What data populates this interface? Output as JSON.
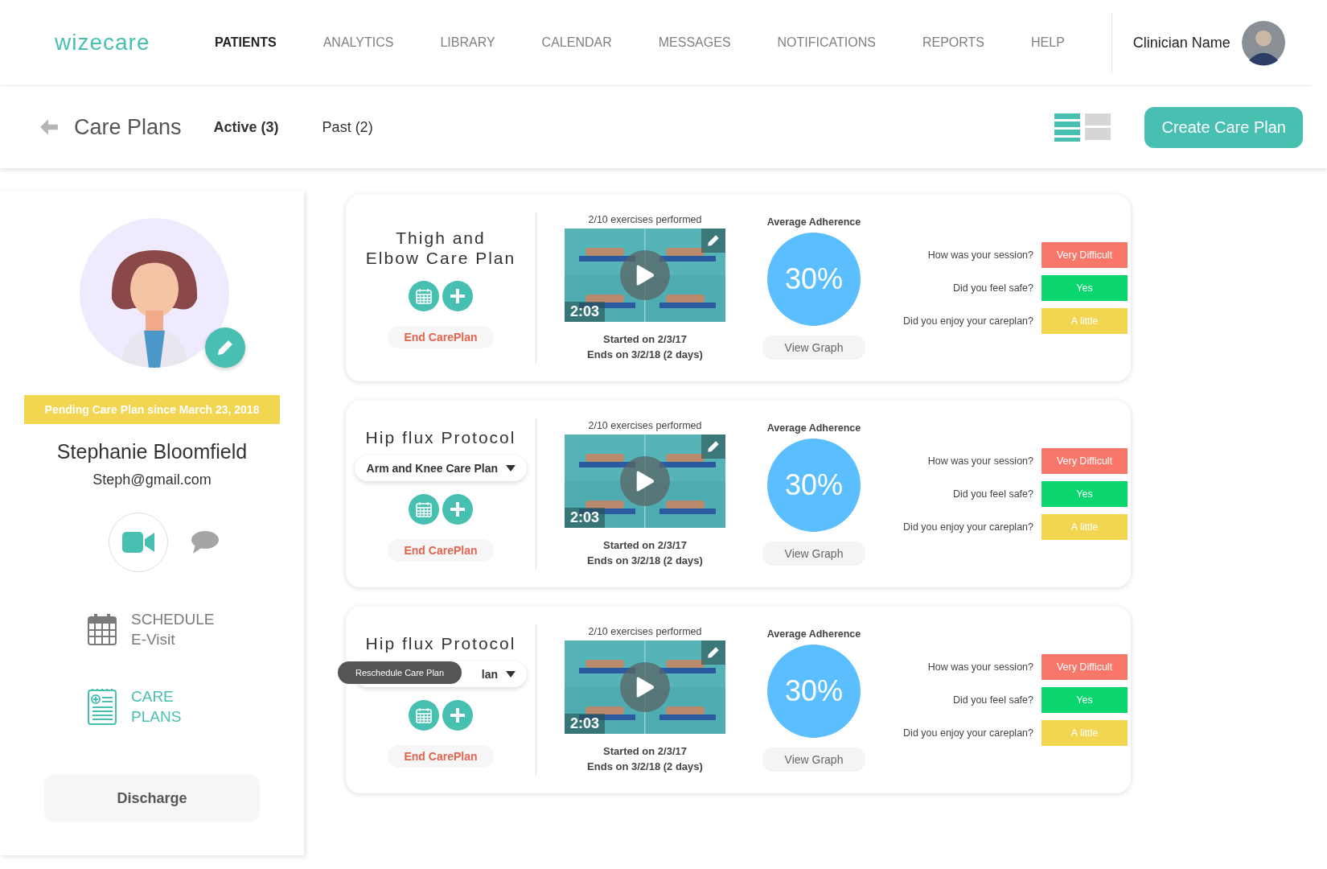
{
  "nav": {
    "logo": "wizecare",
    "items": [
      {
        "label": "PATIENTS",
        "selected": true
      },
      {
        "label": "ANALYTICS",
        "selected": false
      },
      {
        "label": "LIBRARY",
        "selected": false
      },
      {
        "label": "CALENDAR",
        "selected": false
      },
      {
        "label": "MESSAGES",
        "selected": false
      },
      {
        "label": "NOTIFICATIONS",
        "selected": false
      },
      {
        "label": "REPORTS",
        "selected": false
      },
      {
        "label": "HELP",
        "selected": false
      }
    ],
    "user": {
      "name": "Clinician Name"
    }
  },
  "subheader": {
    "title": "Care Plans",
    "tabs": [
      {
        "label": "Active (3)",
        "selected": true
      },
      {
        "label": "Past (2)",
        "selected": false
      }
    ],
    "view_toggle": [
      {
        "kind": "list",
        "selected": true
      },
      {
        "kind": "grid",
        "selected": false
      }
    ],
    "create_button": "Create Care Plan"
  },
  "patient": {
    "pending_banner": "Pending Care Plan since March 23, 2018",
    "name": "Stephanie Bloomfield",
    "email": "Steph@gmail.com",
    "actions": [
      {
        "kind": "schedule",
        "lines": [
          "SCHEDULE",
          "E-Visit"
        ],
        "selected": false
      },
      {
        "kind": "careplans",
        "lines": [
          "CARE",
          "PLANS"
        ],
        "selected": true
      }
    ],
    "discharge_button": "Discharge"
  },
  "care_plans": [
    {
      "title": "Thigh and\nElbow Care Plan",
      "end_button": "End CarePlan",
      "exercises": "2/10 exercises performed",
      "duration": "2:03",
      "started": "Started on 2/3/17",
      "ends": "Ends on 3/2/18 (2 days)",
      "adherence_label": "Average Adherence",
      "adherence": "30%",
      "view_graph": "View Graph",
      "feedback": [
        {
          "question": "How was your session?",
          "answer": "Very Difficult",
          "color": "#f8776a"
        },
        {
          "question": "Did you feel safe?",
          "answer": "Yes",
          "color": "#0bd66e"
        },
        {
          "question": "Did you enjoy your careplan?",
          "answer": "A little",
          "color": "#f2d652"
        }
      ]
    },
    {
      "title": "Hip flux Protocol",
      "dropdown": "Arm and Knee Care Plan",
      "end_button": "End CarePlan",
      "exercises": "2/10 exercises performed",
      "duration": "2:03",
      "started": "Started on 2/3/17",
      "ends": "Ends on 3/2/18 (2 days)",
      "adherence_label": "Average Adherence",
      "adherence": "30%",
      "view_graph": "View Graph",
      "feedback": [
        {
          "question": "How was your session?",
          "answer": "Very Difficult",
          "color": "#f8776a"
        },
        {
          "question": "Did you feel safe?",
          "answer": "Yes",
          "color": "#0bd66e"
        },
        {
          "question": "Did you enjoy your careplan?",
          "answer": "A little",
          "color": "#f2d652"
        }
      ]
    },
    {
      "title": "Hip flux Protocol",
      "dropdown": "lan",
      "tooltip": "Reschedule Care Plan",
      "end_button": "End CarePlan",
      "exercises": "2/10 exercises performed",
      "duration": "2:03",
      "started": "Started on 2/3/17",
      "ends": "Ends on 3/2/18 (2 days)",
      "adherence_label": "Average Adherence",
      "adherence": "30%",
      "view_graph": "View Graph",
      "feedback": [
        {
          "question": "How was your session?",
          "answer": "Very Difficult",
          "color": "#f8776a"
        },
        {
          "question": "Did you feel safe?",
          "answer": "Yes",
          "color": "#0bd66e"
        },
        {
          "question": "Did you enjoy your careplan?",
          "answer": "A little",
          "color": "#f2d652"
        }
      ]
    }
  ]
}
